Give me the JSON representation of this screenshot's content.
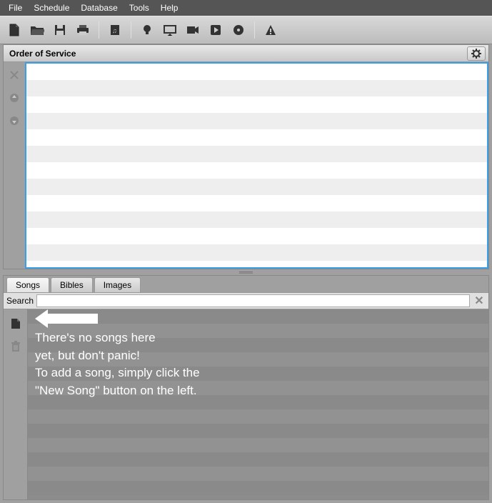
{
  "menubar": {
    "items": [
      "File",
      "Schedule",
      "Database",
      "Tools",
      "Help"
    ]
  },
  "panel_top": {
    "title": "Order of Service"
  },
  "tabs": {
    "items": [
      "Songs",
      "Bibles",
      "Images"
    ],
    "active": "Songs"
  },
  "search": {
    "label": "Search",
    "value": ""
  },
  "empty_message": {
    "line1": "There's no songs here",
    "line2": "yet, but don't panic!",
    "line3": "To add a song, simply click the",
    "line4": "\"New Song\" button on the left."
  }
}
